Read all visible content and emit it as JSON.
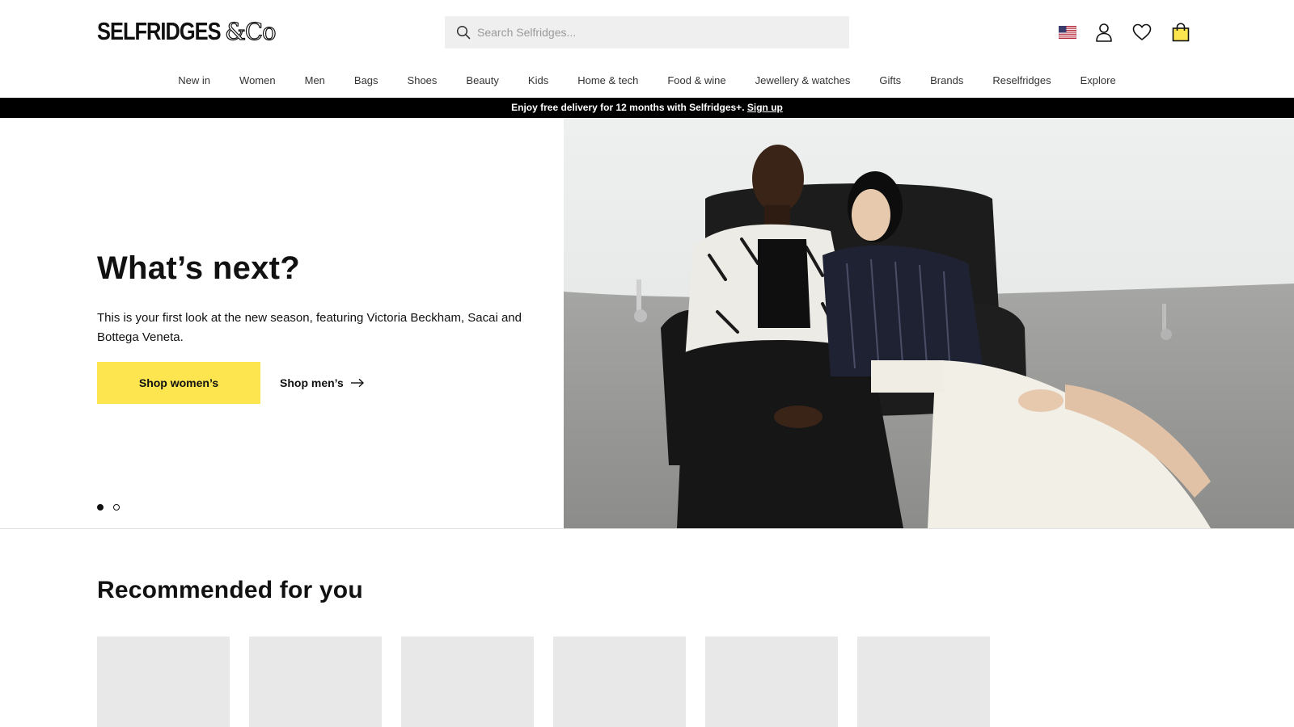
{
  "header": {
    "logo_main": "SELFRIDGES",
    "logo_suffix": "&Co",
    "search_placeholder": "Search Selfridges...",
    "icons": [
      "us-flag-icon",
      "account-icon",
      "wishlist-heart-icon",
      "shopping-bag-icon"
    ]
  },
  "nav": {
    "items": [
      "New in",
      "Women",
      "Men",
      "Bags",
      "Shoes",
      "Beauty",
      "Kids",
      "Home & tech",
      "Food & wine",
      "Jewellery & watches",
      "Gifts",
      "Brands",
      "Reselfridges",
      "Explore"
    ]
  },
  "promo": {
    "text": "Enjoy free delivery for 12 months with Selfridges+.",
    "link": "Sign up"
  },
  "hero": {
    "title": "What’s next?",
    "subtitle": "This is your first look at the new season, featuring Victoria Beckham, Sacai and Bottega Veneta.",
    "primary_cta": "Shop women’s",
    "secondary_cta": "Shop men’s",
    "carousel_active": 1,
    "carousel_total": 2
  },
  "recommended": {
    "title": "Recommended for you",
    "card_count": 6
  },
  "colors": {
    "accent_yellow": "#fce54f",
    "promo_bar": "#000000",
    "search_bg": "#efefef",
    "card_placeholder": "#e8e8e8"
  }
}
